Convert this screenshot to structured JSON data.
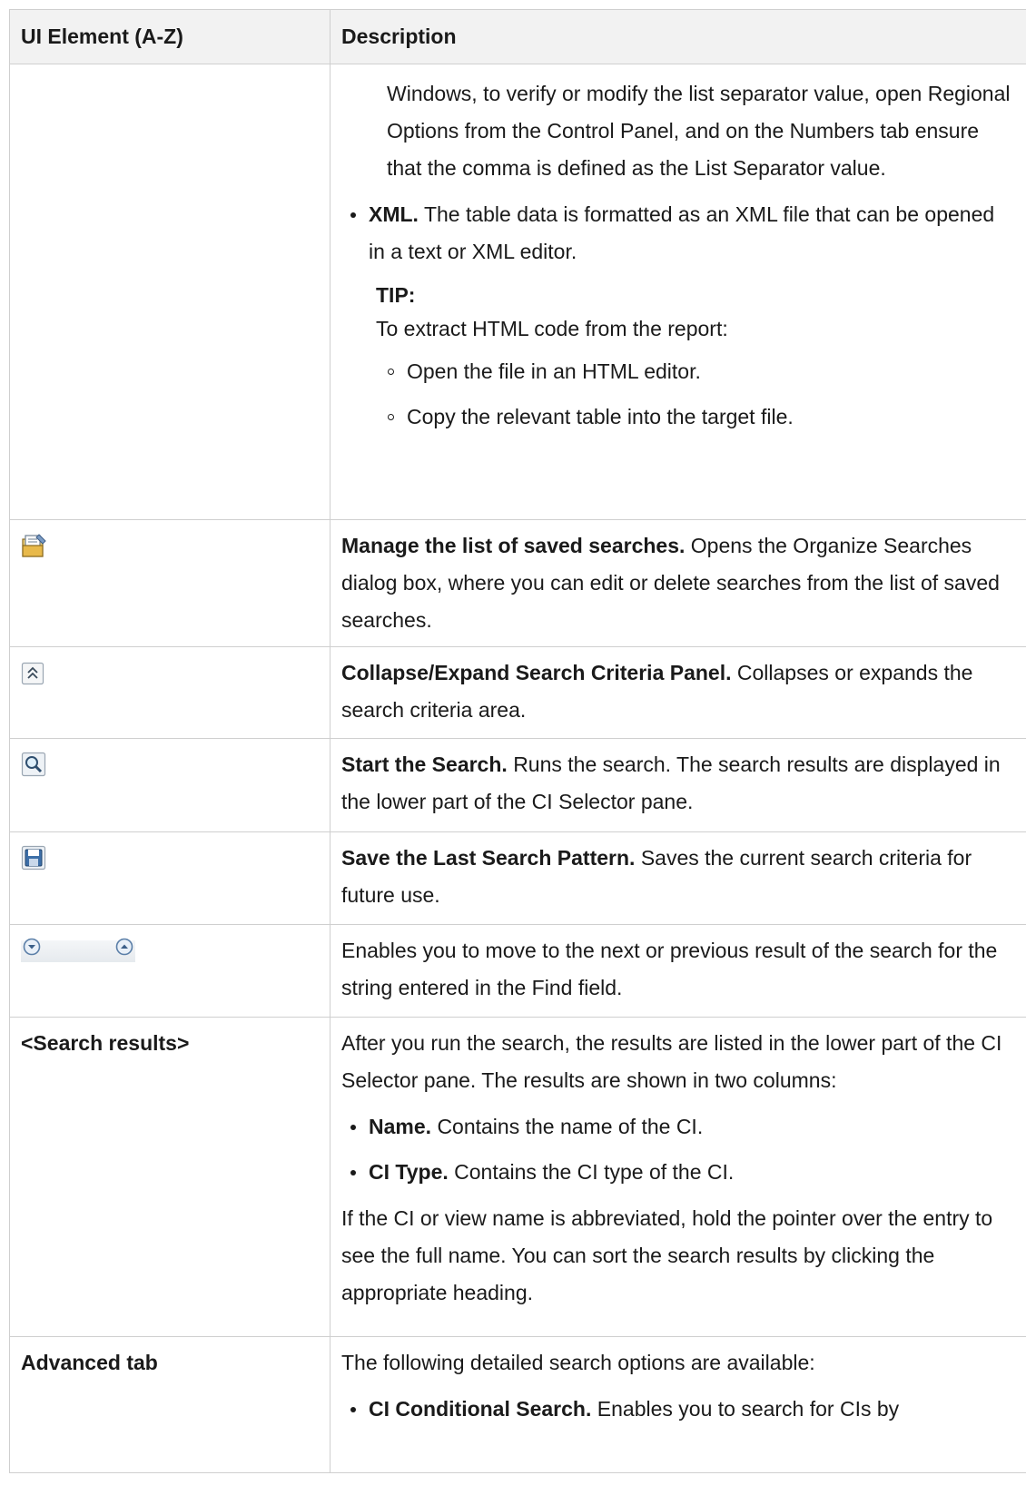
{
  "header": {
    "col1": "UI Element (A-Z)",
    "col2": "Description"
  },
  "row_export": {
    "continued_text": "Windows, to verify or modify the list separator value, open Regional Options from the Control Panel, and on the Numbers tab ensure that the comma is defined as the List Separator value.",
    "xml_title": "XML.",
    "xml_text": "The table data is formatted as an XML file that can be opened in a text or XML editor.",
    "tip_label": "TIP:",
    "tip_text": "To extract HTML code from the report:",
    "tip_items": [
      "Open the file in an HTML editor.",
      "Copy the relevant table into the target file."
    ]
  },
  "row_manage": {
    "icon": "manage-searches-icon",
    "title": "Manage the list of saved searches.",
    "text": "Opens the Organize Searches dialog box, where you can edit or delete searches from the list of saved searches."
  },
  "row_collapse": {
    "icon": "collapse-expand-icon",
    "title": "Collapse/Expand Search Criteria Panel.",
    "text": "Collapses or expands the search criteria area."
  },
  "row_start": {
    "icon": "search-icon",
    "title": "Start the Search.",
    "text": "Runs the search. The search results are displayed in the lower part of the CI Selector pane."
  },
  "row_save": {
    "icon": "save-icon",
    "title": "Save the Last Search Pattern.",
    "text": "Saves the current search criteria for future use."
  },
  "row_nav": {
    "icons": [
      "next-result-icon",
      "previous-result-icon"
    ],
    "text": "Enables you to move to the next or previous result of the search for the string entered in the Find field."
  },
  "row_results": {
    "element": "<Search results>",
    "intro": "After you run the search, the results are listed in the lower part of the CI Selector pane. The results are shown in two columns:",
    "items": [
      {
        "title": "Name.",
        "text": "Contains the name of the CI."
      },
      {
        "title": "CI Type.",
        "text": "Contains the CI type of the CI."
      }
    ],
    "outro": "If the CI or view name is abbreviated, hold the pointer over the entry to see the full name. You can sort the search results by clicking the appropriate heading."
  },
  "row_advanced": {
    "element": "Advanced tab",
    "intro": "The following detailed search options are available:",
    "item_title": "CI Conditional Search.",
    "item_text": "Enables you to search for CIs by"
  }
}
